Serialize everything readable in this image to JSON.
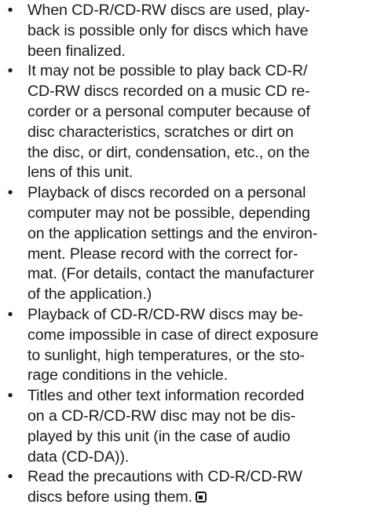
{
  "bullet_symbol": "•",
  "items": [
    {
      "lines": [
        "When CD-R/CD-RW discs are used, play-",
        "back is possible only for discs which have",
        "been finalized."
      ]
    },
    {
      "lines": [
        "It may not be possible to play back CD-R/",
        "CD-RW discs recorded on a music CD re-",
        "corder or a personal computer because of",
        "disc characteristics, scratches or dirt on",
        "the disc, or dirt, condensation, etc., on the",
        "lens of this unit."
      ]
    },
    {
      "lines": [
        "Playback of discs recorded on a personal",
        "computer may not be possible, depending",
        "on the application settings and the environ-",
        "ment. Please record with the correct for-",
        "mat. (For details, contact the manufacturer",
        "of the application.)"
      ]
    },
    {
      "lines": [
        "Playback of CD-R/CD-RW discs may be-",
        "come impossible in case of direct exposure",
        "to sunlight, high temperatures, or the sto-",
        "rage conditions in the vehicle."
      ]
    },
    {
      "lines": [
        "Titles and other text information recorded",
        "on a CD-R/CD-RW disc may not be dis-",
        "played by this unit (in the case of audio",
        "data (CD-DA))."
      ]
    },
    {
      "lines": [
        "Read the precautions with CD-R/CD-RW",
        "discs before using them."
      ],
      "end_mark": "section-end-icon"
    }
  ]
}
